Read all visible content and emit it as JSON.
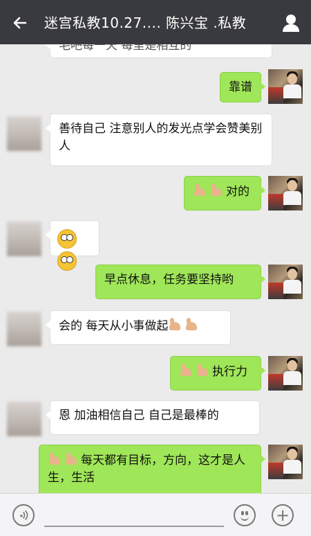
{
  "header": {
    "title": "迷宫私教10.27.... 陈兴宝 .私教",
    "back_icon": "back-arrow-icon",
    "profile_icon": "person-icon",
    "background": "#393a3f"
  },
  "messages": [
    {
      "id": "m0",
      "sender": "other",
      "text": "毛吧每一天 每里是相互的"
    },
    {
      "id": "m1",
      "sender": "me",
      "text": "靠谱"
    },
    {
      "id": "m2",
      "sender": "other",
      "text": "善待自己 注意别人的发光点学会赞美别人"
    },
    {
      "id": "m3",
      "sender": "me",
      "emoji": "muscle-emoji x2",
      "text": "对的"
    },
    {
      "id": "m4",
      "sender": "other",
      "emoji": "surprised-face-emoji x2",
      "text": ""
    },
    {
      "id": "m5",
      "sender": "me",
      "text": "早点休息，任务要坚持哟"
    },
    {
      "id": "m6",
      "sender": "other",
      "text": "会的 每天从小事做起",
      "emoji_after": "muscle-emoji x2"
    },
    {
      "id": "m7",
      "sender": "me",
      "emoji": "muscle-emoji x2",
      "text": "执行力"
    },
    {
      "id": "m8",
      "sender": "other",
      "text": "恩 加油相信自己 自己是最棒的"
    },
    {
      "id": "m9",
      "sender": "me",
      "emoji": "muscle-emoji x2",
      "text": "每天都有目标，方向，这才是人生，生活"
    }
  ],
  "footer": {
    "voice_icon": "voice-icon",
    "emoji_icon": "emoji-icon",
    "plus_icon": "plus-icon",
    "plus_glyph": "+"
  },
  "colors": {
    "me_bubble": "#9fe658",
    "other_bubble": "#ffffff",
    "chat_bg": "#ebebeb"
  }
}
